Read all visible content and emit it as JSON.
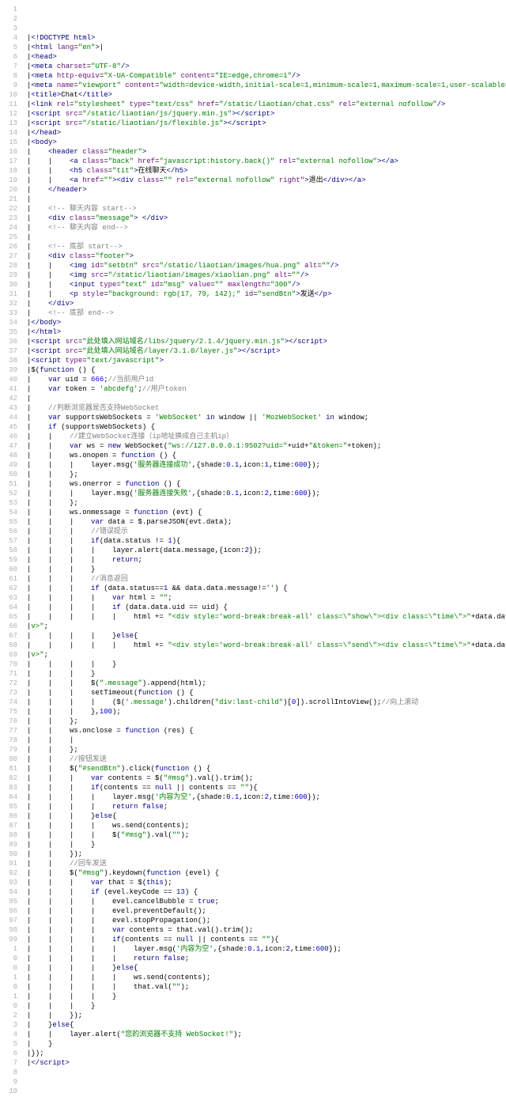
{
  "lines": [
    {
      "n": "1",
      "h": ""
    },
    {
      "n": "2",
      "h": ""
    },
    {
      "n": "3",
      "h": ""
    },
    {
      "n": "4",
      "h": "|<span class=t>&lt;!DOCTYPE html&gt;</span>"
    },
    {
      "n": "5",
      "h": "|<span class=t>&lt;html</span> <span class=a>lang</span>=<span class=s>\"en\"</span><span class=t>&gt;</span>|"
    },
    {
      "n": "6",
      "h": "|<span class=t>&lt;head&gt;</span>"
    },
    {
      "n": "7",
      "h": "|<span class=t>&lt;meta</span> <span class=a>charset</span>=<span class=s>\"UTF-8\"</span><span class=t>/&gt;</span>"
    },
    {
      "n": "8",
      "h": "|<span class=t>&lt;meta</span> <span class=a>http-equiv</span>=<span class=s>\"X-UA-Compatible\"</span> <span class=a>content</span>=<span class=s>\"IE=edge,chrome=1\"</span><span class=t>/&gt;</span>"
    },
    {
      "n": "9",
      "h": "|<span class=t>&lt;meta</span> <span class=a>name</span>=<span class=s>\"viewport\"</span> <span class=a>content</span>=<span class=s>\"width=device-width,initial-scale=1,minimum-scale=1,maximum-scale=1,user-scalable=no\"</span><span class=t>/&gt;</span>"
    },
    {
      "n": "10",
      "h": "|<span class=t>&lt;title&gt;</span>Chat<span class=t>&lt;/title&gt;</span>"
    },
    {
      "n": "11",
      "h": "|<span class=t>&lt;link</span> <span class=a>rel</span>=<span class=s>\"stylesheet\"</span> <span class=a>type</span>=<span class=s>\"text/css\"</span> <span class=a>href</span>=<span class=s>\"/static/liaotian/chat.css\"</span> <span class=a>rel</span>=<span class=s>\"external nofollow\"</span><span class=t>/&gt;</span>"
    },
    {
      "n": "12",
      "h": "|<span class=t>&lt;script</span> <span class=a>src</span>=<span class=s>\"/static/liaotian/js/jquery.min.js\"</span><span class=t>&gt;&lt;/script&gt;</span>"
    },
    {
      "n": "13",
      "h": "|<span class=t>&lt;script</span> <span class=a>src</span>=<span class=s>\"/static/liaotian/js/flexible.js\"</span><span class=t>&gt;&lt;/script&gt;</span>"
    },
    {
      "n": "14",
      "h": "|<span class=t>&lt;/head&gt;</span>"
    },
    {
      "n": "15",
      "h": "|<span class=t>&lt;body&gt;</span>"
    },
    {
      "n": "16",
      "h": "|    <span class=t>&lt;header</span> <span class=a>class</span>=<span class=s>\"header\"</span><span class=t>&gt;</span>"
    },
    {
      "n": "17",
      "h": "|    |    <span class=t>&lt;a</span> <span class=a>class</span>=<span class=s>\"back\"</span> <span class=a>href</span>=<span class=s>\"javascript:history.back()\"</span> <span class=a>rel</span>=<span class=s>\"external nofollow\"</span><span class=t>&gt;&lt;/a&gt;</span>"
    },
    {
      "n": "18",
      "h": "|    |    <span class=t>&lt;h5</span> <span class=a>class</span>=<span class=s>\"tit\"</span><span class=t>&gt;</span>在线聊天<span class=t>&lt;/h5&gt;</span>"
    },
    {
      "n": "19",
      "h": "|    |    <span class=t>&lt;a</span> <span class=a>href</span>=<span class=s>\"\"</span><span class=t>&gt;&lt;div</span> <span class=a>class</span>=<span class=s>\"\"</span> <span class=a>rel</span>=<span class=s>\"external nofollow\"</span> <span class=a>right\"</span><span class=t>&gt;</span>退出<span class=t>&lt;/div&gt;&lt;/a&gt;</span>"
    },
    {
      "n": "20",
      "h": "|    <span class=t>&lt;/header&gt;</span>"
    },
    {
      "n": "21",
      "h": "|"
    },
    {
      "n": "22",
      "h": "|    <span class=c>&lt;!-- 聊天内容 start--&gt;</span>"
    },
    {
      "n": "23",
      "h": "|    <span class=t>&lt;div</span> <span class=a>class</span>=<span class=s>\"message\"</span><span class=t>&gt;</span> <span class=t>&lt;/div&gt;</span>"
    },
    {
      "n": "24",
      "h": "|    <span class=c>&lt;!-- 聊天内容 end--&gt;</span>"
    },
    {
      "n": "25",
      "h": "|"
    },
    {
      "n": "26",
      "h": "|    <span class=c>&lt;!-- 底部 start--&gt;</span>"
    },
    {
      "n": "27",
      "h": "|    <span class=t>&lt;div</span> <span class=a>class</span>=<span class=s>\"footer\"</span><span class=t>&gt;</span>"
    },
    {
      "n": "28",
      "h": "|    |    <span class=t>&lt;img</span> <span class=a>id</span>=<span class=s>\"setbtn\"</span> <span class=a>src</span>=<span class=s>\"/static/liaotian/images/hua.png\"</span> <span class=a>alt</span>=<span class=s>\"\"</span><span class=t>/&gt;</span>"
    },
    {
      "n": "29",
      "h": "|    |    <span class=t>&lt;img</span> <span class=a>src</span>=<span class=s>\"/static/liaotian/images/xiaolian.png\"</span> <span class=a>alt</span>=<span class=s>\"\"</span><span class=t>/&gt;</span>"
    },
    {
      "n": "30",
      "h": "|    |    <span class=t>&lt;input</span> <span class=a>type</span>=<span class=s>\"text\"</span> <span class=a>id</span>=<span class=s>\"msg\"</span> <span class=a>value</span>=<span class=s>\"\"</span> <span class=a>maxlength</span>=<span class=s>\"300\"</span><span class=t>/&gt;</span>"
    },
    {
      "n": "31",
      "h": "|    |    <span class=t>&lt;p</span> <span class=a>style</span>=<span class=s>\"background: rgb(17, 79, 142);\"</span> <span class=a>id</span>=<span class=s>\"sendBtn\"</span><span class=t>&gt;</span>发送<span class=t>&lt;/p&gt;</span>"
    },
    {
      "n": "32",
      "h": "|    <span class=t>&lt;/div&gt;</span>"
    },
    {
      "n": "33",
      "h": "|    <span class=c>&lt;!-- 底部 end--&gt;</span>"
    },
    {
      "n": "34",
      "h": "|<span class=t>&lt;/body&gt;</span>"
    },
    {
      "n": "35",
      "h": "|<span class=t>&lt;/html&gt;</span>"
    },
    {
      "n": "36",
      "h": "|<span class=t>&lt;script</span> <span class=a>src</span>=<span class=s>\"此处填入网站域名/libs/jquery/2.1.4/jquery.min.js\"</span><span class=t>&gt;&lt;/script&gt;</span>"
    },
    {
      "n": "37",
      "h": "|<span class=t>&lt;script</span> <span class=a>src</span>=<span class=s>\"此处填入网站域名/layer/3.1.0/layer.js\"</span><span class=t>&gt;&lt;/script&gt;</span>"
    },
    {
      "n": "38",
      "h": "|<span class=t>&lt;script</span> <span class=a>type</span>=<span class=s>\"text/javascript\"</span><span class=t>&gt;</span>"
    },
    {
      "n": "39",
      "h": "|$(<span class=k>function</span> () {"
    },
    {
      "n": "40",
      "h": "|    <span class=k>var</span> uid = <span class=n>666</span>;<span class=c>//当前用户id</span>"
    },
    {
      "n": "41",
      "h": "|    <span class=k>var</span> token = <span class=s>'abcdefg'</span>;<span class=c>//用户token</span>"
    },
    {
      "n": "42",
      "h": "|"
    },
    {
      "n": "43",
      "h": "|    <span class=c>//判断浏览器是否支持WebSocket</span>"
    },
    {
      "n": "44",
      "h": "|    <span class=k>var</span> supportsWebSockets = <span class=s>'WebSocket'</span> <span class=k>in</span> window || <span class=s>'MozWebSocket'</span> <span class=k>in</span> window;"
    },
    {
      "n": "45",
      "h": "|    <span class=k>if</span> (supportsWebSockets) {"
    },
    {
      "n": "46",
      "h": "|    |    <span class=c>//建立WebSocket连接（ip地址换成自己主机ip）</span>"
    },
    {
      "n": "47",
      "h": "|    |    <span class=k>var</span> ws = <span class=k>new</span> WebSocket(<span class=s>\"ws://127.0.0.0.1:9502?uid=\"</span>+uid+<span class=s>\"&amp;token=\"</span>+token);"
    },
    {
      "n": "48",
      "h": "|    |    ws.onopen = <span class=k>function</span> () {"
    },
    {
      "n": "49",
      "h": "|    |    |    layer.msg(<span class=s>'服务器连接成功'</span>,{shade:<span class=n>0.1</span>,icon:<span class=n>1</span>,time:<span class=n>600</span>});"
    },
    {
      "n": "50",
      "h": "|    |    };"
    },
    {
      "n": "51",
      "h": "|    |    ws.onerror = <span class=k>function</span> () {"
    },
    {
      "n": "52",
      "h": "|    |    |    layer.msg(<span class=s>'服务器连接失败'</span>,{shade:<span class=n>0.1</span>,icon:<span class=n>2</span>,time:<span class=n>600</span>});"
    },
    {
      "n": "53",
      "h": "|    |    };"
    },
    {
      "n": "54",
      "h": "|    |    ws.onmessage = <span class=k>function</span> (evt) {"
    },
    {
      "n": "55",
      "h": "|    |    |    <span class=k>var</span> data = $.parseJSON(evt.data);"
    },
    {
      "n": "56",
      "h": "|    |    |    <span class=c>//错误提示</span>"
    },
    {
      "n": "57",
      "h": "|    |    |    <span class=k>if</span>(data.status != <span class=n>1</span>){"
    },
    {
      "n": "58",
      "h": "|    |    |    |    layer.alert(data.message,{icon:<span class=n>2</span>});"
    },
    {
      "n": "59",
      "h": "|    |    |    |    <span class=k>return</span>;"
    },
    {
      "n": "60",
      "h": "|    |    |    }"
    },
    {
      "n": "61",
      "h": "|    |    |    <span class=c>//消息返回</span>"
    },
    {
      "n": "62",
      "h": "|    |    |    <span class=k>if</span> (data.status==<span class=n>1</span> &amp;&amp; data.data.message!=<span class=s>''</span>) {"
    },
    {
      "n": "63",
      "h": "|    |    |    |    <span class=k>var</span> html = <span class=s>\"\"</span>;"
    },
    {
      "n": "64",
      "h": "|    |    |    |    <span class=k>if</span> (data.data.uid == uid) {"
    },
    {
      "n": "65",
      "h": "|    |    |    |    |    html += <span class=s>\"&lt;div style='word-break:break-all' class=\\\"show\\\"&gt;&lt;div class=\\\"time\\\"&gt;\"</span>+data.data.post_time+<span class=s>\"&lt;/div&gt;&lt;div class=\\\"msg\\\"&gt;&lt;img src=\\\"\"</span>+data.data.head_img+<span class=s>\"\\\" alt=\\\"\\\" /&gt;&lt;p&gt;&lt;i class=\\\"msg_input\\\"&gt;&lt;/i&gt;\"</span>+data.data.message+<span class=s>\"&lt;/p&gt;&lt;/div&gt;&lt;/di</span>"
    },
    {
      "n": "66",
      "h": "|<span class=s>v&gt;\"</span>;"
    },
    {
      "n": "67",
      "h": "|    |    |    |    }<span class=k>else</span>{"
    },
    {
      "n": "68",
      "h": "|    |    |    |    |    html += <span class=s>\"&lt;div style='word-break:break-all' class=\\\"send\\\"&gt;&lt;div class=\\\"time\\\"&gt;\"</span>+data.data.post_time+<span class=s>\"&lt;/div&gt;&lt;div class=\\\"msg\\\"&gt;&lt;img src=\\\"\"</span>+data.data.head_img+<span class=s>\"\\\" alt=\\\"\\\" /&gt;&lt;p&gt;&lt;i class=\\\"msg_input\\\"&gt;&lt;/i&gt;\"</span>+data.data.message+<span class=s>\"&lt;/p&gt;&lt;/div&gt;&lt;/di</span>"
    },
    {
      "n": "69",
      "h": "|<span class=s>v&gt;\"</span>;"
    },
    {
      "n": "70",
      "h": "|    |    |    |    }"
    },
    {
      "n": "71",
      "h": "|    |    |    }"
    },
    {
      "n": "72",
      "h": "|    |    |    $(<span class=s>\".message\"</span>).append(html);"
    },
    {
      "n": "73",
      "h": "|    |    |    setTimeout(<span class=k>function</span> () {"
    },
    {
      "n": "74",
      "h": "|    |    |    |    ($(<span class=s>'.message'</span>).children(<span class=s>\"div:last-child\"</span>)[<span class=n>0</span>]).scrollIntoView();<span class=c>//向上滚动</span>"
    },
    {
      "n": "75",
      "h": "|    |    |    },<span class=n>100</span>);"
    },
    {
      "n": "76",
      "h": "|    |    };"
    },
    {
      "n": "77",
      "h": "|    |    ws.onclose = <span class=k>function</span> (res) {"
    },
    {
      "n": "78",
      "h": "|    |    |    "
    },
    {
      "n": "79",
      "h": "|    |    };"
    },
    {
      "n": "80",
      "h": "|    |    <span class=c>//按钮发送</span>"
    },
    {
      "n": "81",
      "h": "|    |    $(<span class=s>\"#sendBtn\"</span>).click(<span class=k>function</span> () {"
    },
    {
      "n": "82",
      "h": "|    |    |    <span class=k>var</span> contents = $(<span class=s>\"#msg\"</span>).val().trim();"
    },
    {
      "n": "83",
      "h": "|    |    |    <span class=k>if</span>(contents == <span class=k>null</span> || contents == <span class=s>\"\"</span>){"
    },
    {
      "n": "84",
      "h": "|    |    |    |    layer.msg(<span class=s>'内容为空'</span>,{shade:<span class=n>0.1</span>,icon:<span class=n>2</span>,time:<span class=n>600</span>});"
    },
    {
      "n": "85",
      "h": "|    |    |    |    <span class=k>return false</span>;"
    },
    {
      "n": "86",
      "h": "|    |    |    }<span class=k>else</span>{"
    },
    {
      "n": "87",
      "h": "|    |    |    |    ws.send(contents);"
    },
    {
      "n": "88",
      "h": "|    |    |    |    $(<span class=s>\"#msg\"</span>).val(<span class=s>\"\"</span>);"
    },
    {
      "n": "89",
      "h": "|    |    |    }"
    },
    {
      "n": "90",
      "h": "|    |    });"
    },
    {
      "n": "91",
      "h": "|    |    <span class=c>//回车发送</span>"
    },
    {
      "n": "92",
      "h": "|    |    $(<span class=s>\"#msg\"</span>).keydown(<span class=k>function</span> (evel) {"
    },
    {
      "n": "93",
      "h": "|    |    |    <span class=k>var</span> that = $(<span class=k>this</span>);"
    },
    {
      "n": "94",
      "h": "|    |    |    <span class=k>if</span> (evel.keyCode == <span class=n>13</span>) {"
    },
    {
      "n": "95",
      "h": "|    |    |    |    evel.cancelBubble = <span class=k>true</span>;"
    },
    {
      "n": "96",
      "h": "|    |    |    |    evel.preventDefault();"
    },
    {
      "n": "97",
      "h": "|    |    |    |    evel.stopPropagation();"
    },
    {
      "n": "98",
      "h": "|    |    |    |    <span class=k>var</span> contents = that.val().trim();"
    },
    {
      "n": "99",
      "h": "|    |    |    |    <span class=k>if</span>(contents == <span class=k>null</span> || contents == <span class=s>\"\"</span>){"
    },
    {
      "n": "1",
      "h": "|    |    |    |    |    layer.msg(<span class=s>'内容为空'</span>,{shade:<span class=n>0.1</span>,icon:<span class=n>2</span>,time:<span class=n>600</span>});"
    },
    {
      "n": "0",
      "h": "|    |    |    |    |    <span class=k>return false</span>;"
    },
    {
      "n": "0",
      "h": "|    |    |    |    }<span class=k>else</span>{"
    },
    {
      "n": "1",
      "h": "|    |    |    |    |    ws.send(contents);"
    },
    {
      "n": "0",
      "h": "|    |    |    |    |    that.val(<span class=s>\"\"</span>);"
    },
    {
      "n": "1",
      "h": "|    |    |    |    }"
    },
    {
      "n": "0",
      "h": "|    |    |    }"
    },
    {
      "n": "2",
      "h": "|    |    });"
    },
    {
      "n": "3",
      "h": "|    }<span class=k>else</span>{"
    },
    {
      "n": "4",
      "h": "|    |    layer.alert(<span class=s>\"您的浏览器不支持 WebSocket!\"</span>);"
    },
    {
      "n": "5",
      "h": "|    }"
    },
    {
      "n": "6",
      "h": "|});"
    },
    {
      "n": "7",
      "h": "|<span class=t>&lt;/script&gt;</span>"
    },
    {
      "n": "8",
      "h": ""
    },
    {
      "n": "9",
      "h": ""
    },
    {
      "n": "10",
      "h": ""
    }
  ]
}
